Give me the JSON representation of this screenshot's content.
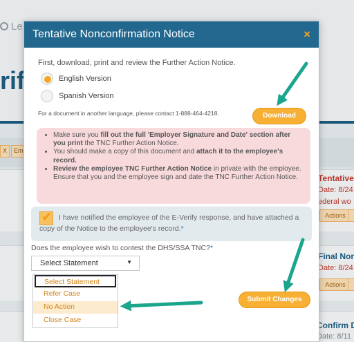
{
  "background": {
    "breadcrumb": "Le",
    "logo_fragment": "rify",
    "tags": [
      "X",
      "Em"
    ],
    "cases": [
      {
        "title": "Tentative",
        "date": "Date: 8/24",
        "subtext": "ederal wo",
        "action": "Actions"
      },
      {
        "title": "Final Non",
        "date": "Date: 8/24",
        "action": "Actions"
      },
      {
        "title": "Confirm D",
        "date": "Date: 8/11"
      }
    ]
  },
  "modal": {
    "title": "Tentative Nonconfirmation Notice",
    "close_glyph": "×",
    "intro": "First, download, print and review the Further Action Notice.",
    "languages": [
      {
        "label": "English Version",
        "selected": true
      },
      {
        "label": "Spanish Version",
        "selected": false
      }
    ],
    "contact_note": "For a document in another language, please contact 1-888-464-4218.",
    "download_label": "Download",
    "instructions": [
      {
        "parts": [
          {
            "text": "Make sure you ",
            "bold": false
          },
          {
            "text": "fill out the full 'Employer Signature and Date' section after you print",
            "bold": true
          },
          {
            "text": " the TNC Further Action Notice.",
            "bold": false
          }
        ]
      },
      {
        "parts": [
          {
            "text": "You should make a copy of this document and ",
            "bold": false
          },
          {
            "text": "attach it to the employee's record.",
            "bold": true
          }
        ]
      },
      {
        "parts": [
          {
            "text": "Review the employee TNC Further Action Notice",
            "bold": true
          },
          {
            "text": " in private with the employee. Ensure that you and the employee sign and date the TNC Further Action Notice.",
            "bold": false
          }
        ]
      }
    ],
    "acknowledgement": "I have notified the employee of the E-Verify response, and have attached a copy of the Notice to the employee's record.",
    "required_mark": "*",
    "contest_question": "Does the employee wish to contest the DHS/SSA TNC?",
    "select_value": "Select Statement",
    "select_options": [
      "Select Statement",
      "Refer Case",
      "No Action",
      "Close Case"
    ],
    "submit_label": "Submit Changes"
  },
  "colors": {
    "header_blue": "#22678e",
    "accent_orange": "#f7b033",
    "arrow_teal": "#1aa58c",
    "notice_pink": "#f8dadd"
  }
}
